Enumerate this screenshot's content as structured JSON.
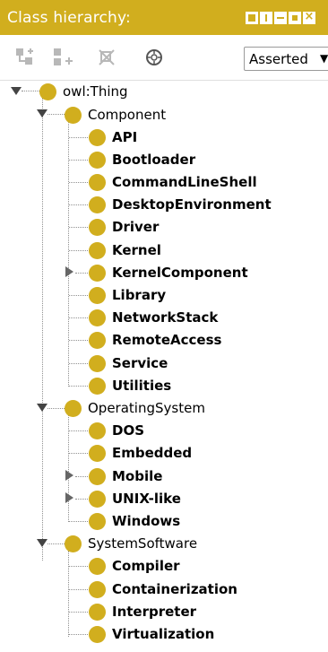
{
  "panel": {
    "title": "Class hierarchy:"
  },
  "toolbar": {
    "hierarchy_mode": "Asserted"
  },
  "tree": {
    "root": "owl:Thing",
    "groups": [
      {
        "label": "Component",
        "children": [
          "API",
          "Bootloader",
          "CommandLineShell",
          "DesktopEnvironment",
          "Driver",
          "Kernel",
          "KernelComponent",
          "Library",
          "NetworkStack",
          "RemoteAccess",
          "Service",
          "Utilities"
        ]
      },
      {
        "label": "OperatingSystem",
        "children": [
          "DOS",
          "Embedded",
          "Mobile",
          "UNIX-like",
          "Windows"
        ]
      },
      {
        "label": "SystemSoftware",
        "children": [
          "Compiler",
          "Containerization",
          "Interpreter",
          "Virtualization"
        ]
      }
    ]
  },
  "colors": {
    "accent": "#d1ae1e"
  }
}
